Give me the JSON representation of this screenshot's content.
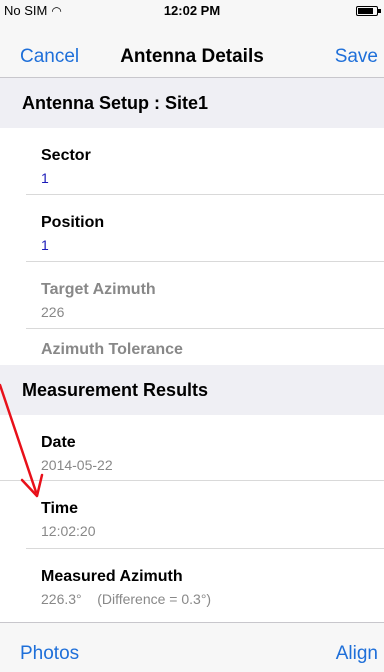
{
  "status_bar": {
    "carrier": "No SIM",
    "wifi_icon": "wifi-icon",
    "time": "12:02 PM",
    "battery_icon": "battery-icon"
  },
  "nav": {
    "cancel": "Cancel",
    "title": "Antenna Details",
    "save": "Save"
  },
  "sections": {
    "setup": {
      "header": "Antenna Setup : Site1",
      "sector": {
        "label": "Sector",
        "value": "1"
      },
      "position": {
        "label": "Position",
        "value": "1"
      },
      "target_azimuth": {
        "label": "Target Azimuth",
        "value": "226"
      },
      "azimuth_tolerance": {
        "label": "Azimuth Tolerance"
      }
    },
    "results": {
      "header": "Measurement Results",
      "date": {
        "label": "Date",
        "value": "2014-05-22"
      },
      "time": {
        "label": "Time",
        "value": "12:02:20"
      },
      "measured_azimuth": {
        "label": "Measured Azimuth",
        "value": "226.3°    (Difference = 0.3°)"
      }
    }
  },
  "toolbar": {
    "photos": "Photos",
    "align": "Align"
  },
  "colors": {
    "accent": "#1e6fd9",
    "annotation_arrow": "#e8101a",
    "value_blue": "#1a1ab8"
  }
}
